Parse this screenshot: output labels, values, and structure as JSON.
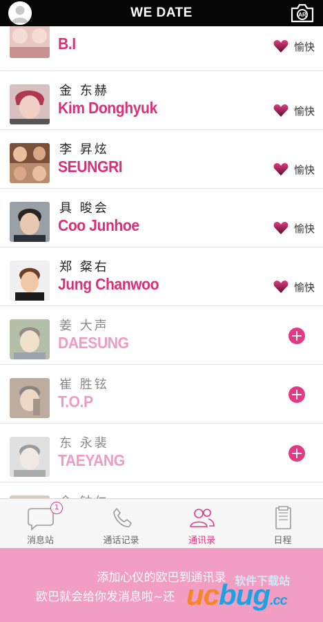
{
  "header": {
    "title": "WE DATE",
    "camera_icon": "camera-icon",
    "profile_icon": "user-avatar-icon"
  },
  "contacts": [
    {
      "cn_name": "",
      "en_name": "B.I",
      "status": "added",
      "mood": "愉快",
      "photo_colors": [
        "#c8a6a0",
        "#f0d8d0"
      ]
    },
    {
      "cn_name": "金 东赫",
      "en_name": "Kim Donghyuk",
      "status": "added",
      "mood": "愉快",
      "photo_colors": [
        "#b04050",
        "#e8c0b8"
      ]
    },
    {
      "cn_name": "李 昇炫",
      "en_name": "SEUNGRI",
      "status": "added",
      "mood": "愉快",
      "photo_colors": [
        "#8a5a40",
        "#d8b090"
      ]
    },
    {
      "cn_name": "具 晙会",
      "en_name": "Coo Junhoe",
      "status": "added",
      "mood": "愉快",
      "photo_colors": [
        "#2a3038",
        "#c8a890"
      ]
    },
    {
      "cn_name": "郑 粲右",
      "en_name": "Jung Chanwoo",
      "status": "added",
      "mood": "愉快",
      "photo_colors": [
        "#222222",
        "#e0b090"
      ]
    },
    {
      "cn_name": "姜 大声",
      "en_name": "DAESUNG",
      "status": "not_added",
      "mood": "",
      "photo_colors": [
        "#7a8a60",
        "#d8c0a0"
      ]
    },
    {
      "cn_name": "崔 胜铉",
      "en_name": "T.O.P",
      "status": "not_added",
      "mood": "",
      "photo_colors": [
        "#5a4030",
        "#c8a080"
      ]
    },
    {
      "cn_name": "东 永裴",
      "en_name": "TAEYANG",
      "status": "not_added",
      "mood": "",
      "photo_colors": [
        "#6a6a6a",
        "#d0c0b8"
      ]
    },
    {
      "cn_name": "金 钟仁",
      "en_name": "",
      "status": "not_added",
      "mood": "",
      "photo_colors": [
        "#6a5a50",
        "#d8c0b0"
      ]
    }
  ],
  "tabs": [
    {
      "label": "消息站",
      "icon": "chat-bubble-icon",
      "badge": "1",
      "active": false
    },
    {
      "label": "通话记录",
      "icon": "phone-icon",
      "badge": "",
      "active": false
    },
    {
      "label": "通讯录",
      "icon": "contacts-icon",
      "badge": "",
      "active": true
    },
    {
      "label": "日程",
      "icon": "notebook-icon",
      "badge": "",
      "active": false
    }
  ],
  "banner": {
    "line1": "添加心仪的欧巴到通讯录",
    "line2": "欧巴就会给你发消息啦~还",
    "watermark_cn": "软件下载站",
    "watermark_en_uc": "uc",
    "watermark_en_bug": "bug",
    "watermark_en_cc": ".cc"
  },
  "colors": {
    "accent": "#e23a82",
    "name_pink": "#d9307a",
    "banner_pink": "#f29ec3"
  }
}
